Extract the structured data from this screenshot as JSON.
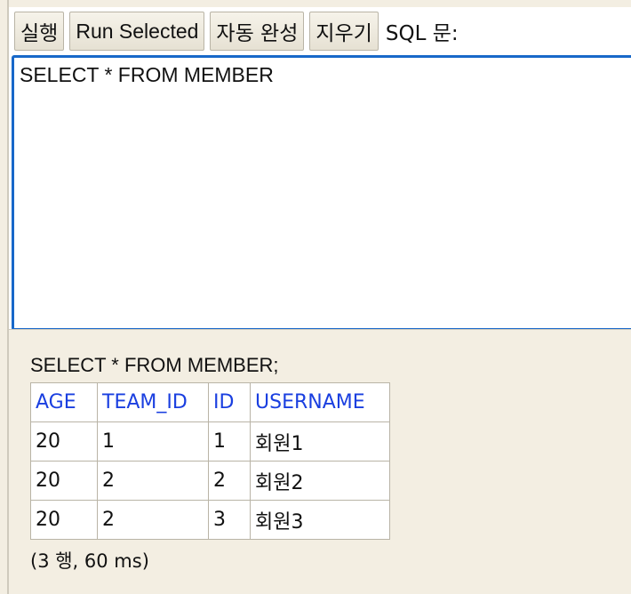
{
  "toolbar": {
    "run_label": "실행",
    "run_selected_label": "Run Selected",
    "autocomplete_label": "자동 완성",
    "clear_label": "지우기",
    "sql_label": "SQL 문:"
  },
  "editor": {
    "value": "SELECT * FROM MEMBER"
  },
  "result": {
    "statement": "SELECT * FROM MEMBER;",
    "columns": [
      "AGE",
      "TEAM_ID",
      "ID",
      "USERNAME"
    ],
    "rows": [
      [
        "20",
        "1",
        "1",
        "회원1"
      ],
      [
        "20",
        "2",
        "2",
        "회원2"
      ],
      [
        "20",
        "2",
        "3",
        "회원3"
      ]
    ],
    "summary": "(3 행, 60 ms)"
  }
}
